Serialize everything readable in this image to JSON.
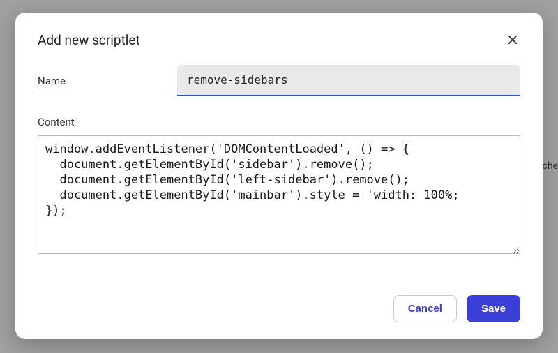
{
  "modal": {
    "title": "Add new scriptlet",
    "fields": {
      "name": {
        "label": "Name",
        "value": "remove-sidebars"
      },
      "content": {
        "label": "Content",
        "value": "window.addEventListener('DOMContentLoaded', () => {\n  document.getElementById('sidebar').remove();\n  document.getElementById('left-sidebar').remove();\n  document.getElementById('mainbar').style = 'width: 100%;\n});"
      }
    },
    "buttons": {
      "cancel": "Cancel",
      "save": "Save"
    }
  },
  "backdrop": {
    "fragment": "che"
  }
}
